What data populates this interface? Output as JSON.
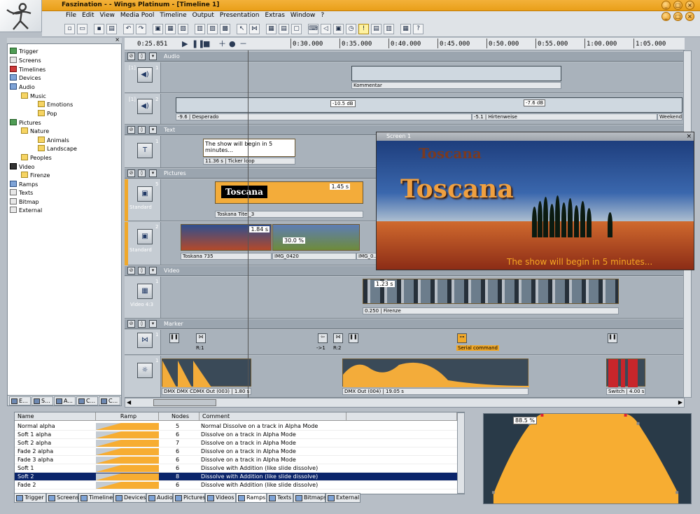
{
  "window": {
    "title": "Faszination - - Wings Platinum - [Timeline 1]"
  },
  "menu": [
    "File",
    "Edit",
    "View",
    "Media Pool",
    "Timeline",
    "Output",
    "Presentation",
    "Extras",
    "Window",
    "?"
  ],
  "tree": [
    {
      "label": "Trigger",
      "level": 0,
      "icon": "trigger-icon"
    },
    {
      "label": "Screens",
      "level": 0,
      "icon": "screen-icon"
    },
    {
      "label": "Timelines",
      "level": 0,
      "icon": "timeline-icon"
    },
    {
      "label": "Devices",
      "level": 0,
      "icon": "device-icon"
    },
    {
      "label": "Audio",
      "level": 0,
      "icon": "audio-icon"
    },
    {
      "label": "Music",
      "level": 1,
      "icon": "folder-icon"
    },
    {
      "label": "Emotions",
      "level": 2,
      "icon": "folder-icon"
    },
    {
      "label": "Pop",
      "level": 2,
      "icon": "folder-icon"
    },
    {
      "label": "Pictures",
      "level": 0,
      "icon": "picture-icon"
    },
    {
      "label": "Nature",
      "level": 1,
      "icon": "folder-icon"
    },
    {
      "label": "Animals",
      "level": 2,
      "icon": "folder-icon"
    },
    {
      "label": "Landscape",
      "level": 2,
      "icon": "folder-icon"
    },
    {
      "label": "Peoples",
      "level": 1,
      "icon": "folder-icon"
    },
    {
      "label": "Video",
      "level": 0,
      "icon": "video-icon"
    },
    {
      "label": "Firenze",
      "level": 1,
      "icon": "folder-icon"
    },
    {
      "label": "Ramps",
      "level": 0,
      "icon": "ramp-icon"
    },
    {
      "label": "Texts",
      "level": 0,
      "icon": "text-icon"
    },
    {
      "label": "Bitmap",
      "level": 0,
      "icon": "bitmap-icon"
    },
    {
      "label": "External",
      "level": 0,
      "icon": "external-icon"
    }
  ],
  "left_tabs": [
    "E...",
    "S...",
    "A...",
    "C...",
    "C..."
  ],
  "timeline": {
    "timecode": "0:25.851",
    "ticks": [
      "0:30.000",
      "0:35.000",
      "0:40.000",
      "0:45.000",
      "0:50.000",
      "0:55.000",
      "1:00.000",
      "1:05.000"
    ],
    "groups": {
      "audio": "Audio",
      "text": "Text",
      "pictures": "Pictures",
      "video": "Video",
      "marker": "Marker"
    },
    "audio1": {
      "num": "1",
      "tag": "[1]",
      "clip": "Kommentar"
    },
    "audio2": {
      "num": "2",
      "tag": "[1]",
      "clip_a": "-9.6 | Desperado",
      "clip_b": "-5.1 | Hirtenweise",
      "clip_c": "Weekend",
      "db1": "-10.5 dB",
      "db2": "-7.6 dB"
    },
    "text1": {
      "num": "1",
      "clip_text": "The show will begin in 5 minutes...",
      "clip": "11.36 s | Ticker loop"
    },
    "pic5": {
      "num": "5",
      "label": "Standard",
      "clip": "Toskana Titel_3",
      "duration": "1.45 s",
      "title": "Toscana"
    },
    "pic2": {
      "num": "2",
      "label": "Standard",
      "clip_a": "Toskana 735",
      "clip_b": "IMG_0420",
      "clip_c": "IMG_0...",
      "duration": "1.84 s",
      "pct": "30.0 %"
    },
    "video1": {
      "num": "1",
      "label": "Video 4:3",
      "clip": "0.250 | Firenze",
      "duration": "1.23 s"
    },
    "marker": {
      "num": "1",
      "m1": "R:1",
      "m2": "->1",
      "m3": "R:2",
      "serial": "Serial command"
    },
    "dmx": {
      "num": "1",
      "clip_a": "DMX",
      "clip_b": "DMX",
      "clip_c": "CDMX Out (003) | 1.80 s",
      "clip_d": "DMX Out (004) | 19.05 s",
      "clip_e": "Switch | 4.00 s"
    }
  },
  "preview": {
    "title": "Screen 1",
    "headline": "Toscana",
    "subtitle": "The show will begin in 5 minutes..."
  },
  "ramps_table": {
    "columns": [
      "Name",
      "Ramp",
      "Nodes",
      "Comment"
    ],
    "rows": [
      {
        "name": "Normal alpha",
        "nodes": "5",
        "comment": "Normal Dissolve on a track in Alpha Mode"
      },
      {
        "name": "Soft 1 alpha",
        "nodes": "6",
        "comment": "Dissolve on a track in Alpha Mode"
      },
      {
        "name": "Soft 2 alpha",
        "nodes": "7",
        "comment": "Dissolve on a track in Alpha Mode"
      },
      {
        "name": "Fade 2 alpha",
        "nodes": "6",
        "comment": "Dissolve on a track in Alpha Mode"
      },
      {
        "name": "Fade 3 alpha",
        "nodes": "6",
        "comment": "Dissolve on a track in Alpha Mode"
      },
      {
        "name": "Soft 1",
        "nodes": "6",
        "comment": "Dissolve with Addition (like slide dissolve)"
      },
      {
        "name": "Soft 2",
        "nodes": "8",
        "comment": "Dissolve with Addition (like slide dissolve)",
        "selected": true
      },
      {
        "name": "Fade 2",
        "nodes": "6",
        "comment": "Dissolve with Addition (like slide dissolve)"
      }
    ]
  },
  "bottom_tabs": [
    "Trigger",
    "Screens",
    "Timelines",
    "Devices",
    "Audio",
    "Pictures",
    "Videos",
    "Ramps",
    "Texts",
    "Bitmaps",
    "External"
  ],
  "ramp_graph": {
    "label": "88.5 %"
  },
  "colors": {
    "accent": "#f0a82a",
    "selection": "#0a246a"
  }
}
